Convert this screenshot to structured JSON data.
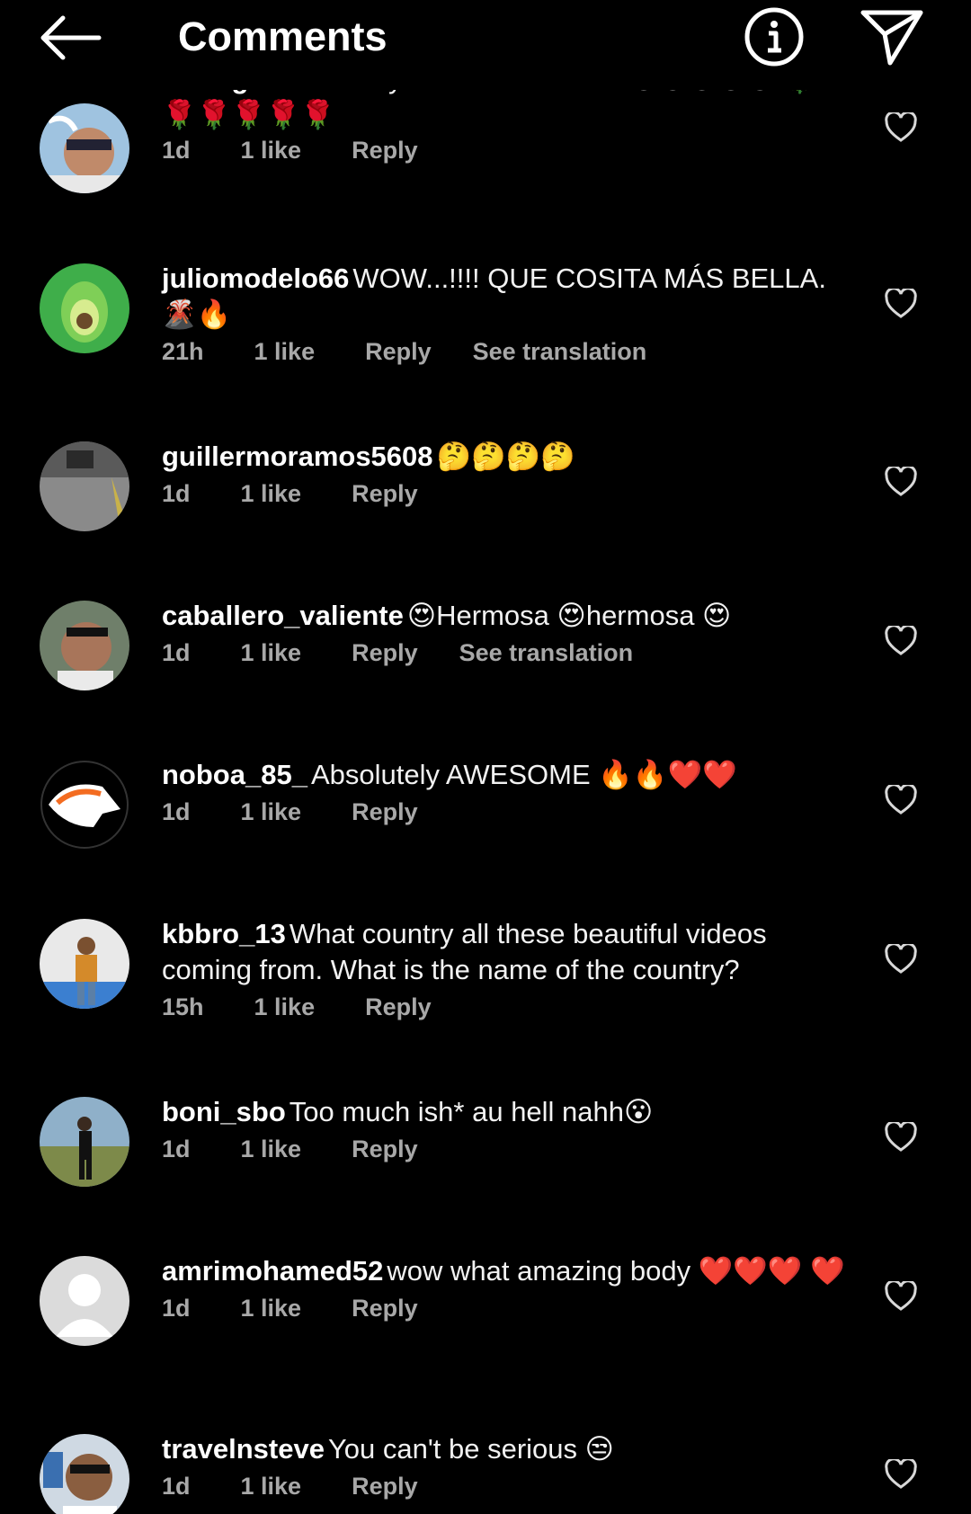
{
  "header": {
    "title": "Comments"
  },
  "icons": {
    "back": "back-arrow-icon",
    "info": "info-icon",
    "send": "send-icon",
    "like": "heart-outline-icon"
  },
  "colors": {
    "background": "#000000",
    "text": "#ffffff",
    "meta": "#a8a8a8"
  },
  "comments": [
    {
      "username": "theorgieblanco",
      "text": "my heart can't take it 😍😍😍😍😍 🌹🌹🌹🌹🌹🌹",
      "time": "1d",
      "likes": "1 like",
      "reply": "Reply",
      "translation": ""
    },
    {
      "username": "juliomodelo66",
      "text": "WOW...!!!! QUE COSITA MÁS BELLA. 🌋🔥",
      "time": "21h",
      "likes": "1 like",
      "reply": "Reply",
      "translation": "See translation"
    },
    {
      "username": "guillermoramos5608",
      "text": "🤔🤔🤔🤔",
      "time": "1d",
      "likes": "1 like",
      "reply": "Reply",
      "translation": ""
    },
    {
      "username": "caballero_valiente",
      "text": "😍Hermosa 😍hermosa 😍",
      "time": "1d",
      "likes": "1 like",
      "reply": "Reply",
      "translation": "See translation"
    },
    {
      "username": "noboa_85_",
      "text": "Absolutely AWESOME 🔥🔥❤️❤️",
      "time": "1d",
      "likes": "1 like",
      "reply": "Reply",
      "translation": ""
    },
    {
      "username": "kbbro_13",
      "text": "What country all these beautiful videos coming from. What is the name of the country?",
      "time": "15h",
      "likes": "1 like",
      "reply": "Reply",
      "translation": ""
    },
    {
      "username": "boni_sbo",
      "text": "Too much ish* au hell nahh😮",
      "time": "1d",
      "likes": "1 like",
      "reply": "Reply",
      "translation": ""
    },
    {
      "username": "amrimohamed52",
      "text": "wow what amazing body ❤️❤️❤️ ❤️",
      "time": "1d",
      "likes": "1 like",
      "reply": "Reply",
      "translation": ""
    },
    {
      "username": "travelnsteve",
      "text": "You can't be serious 😒",
      "time": "1d",
      "likes": "1 like",
      "reply": "Reply",
      "translation": ""
    }
  ]
}
